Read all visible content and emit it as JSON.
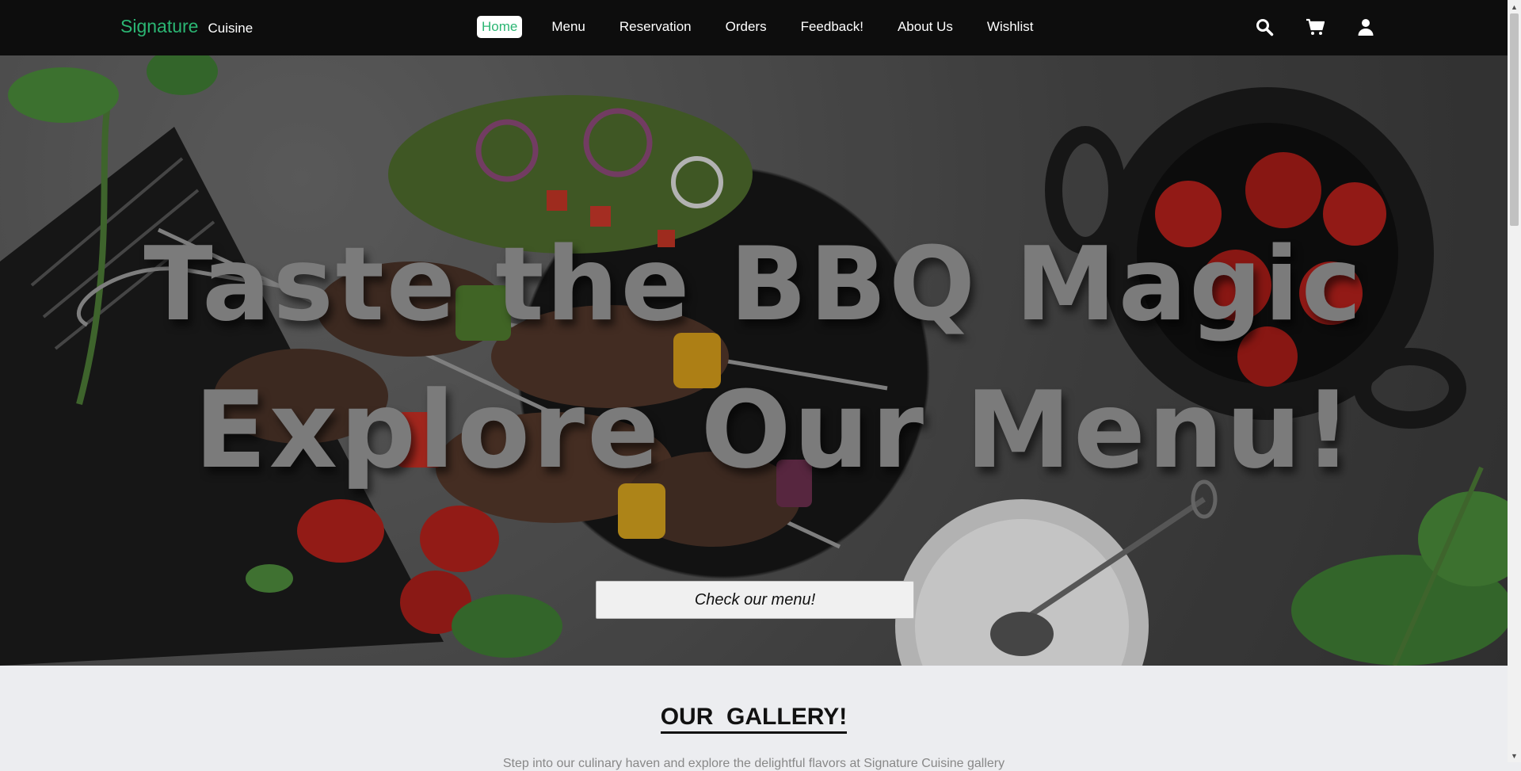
{
  "brand": {
    "name": "Signature",
    "subtitle": "Cuisine"
  },
  "nav": {
    "items": [
      {
        "label": "Home",
        "active": true
      },
      {
        "label": "Menu"
      },
      {
        "label": "Reservation"
      },
      {
        "label": "Orders"
      },
      {
        "label": "Feedback!"
      },
      {
        "label": "About Us"
      },
      {
        "label": "Wishlist"
      }
    ],
    "icons": [
      "search-icon",
      "cart-icon",
      "user-icon"
    ]
  },
  "hero": {
    "line1": "Taste the BBQ Magic",
    "line2": "Explore Our Menu!",
    "button_label": "Check our menu!"
  },
  "gallery": {
    "title": "OUR  GALLERY!",
    "description": "Step into our culinary haven and explore the delightful flavors at Signature Cuisine gallery"
  },
  "colors": {
    "navbar": "#0d0d0d",
    "brand_accent": "#2bb673",
    "page_bg": "#ecedf0",
    "hero_text": "#7b7b7b"
  }
}
